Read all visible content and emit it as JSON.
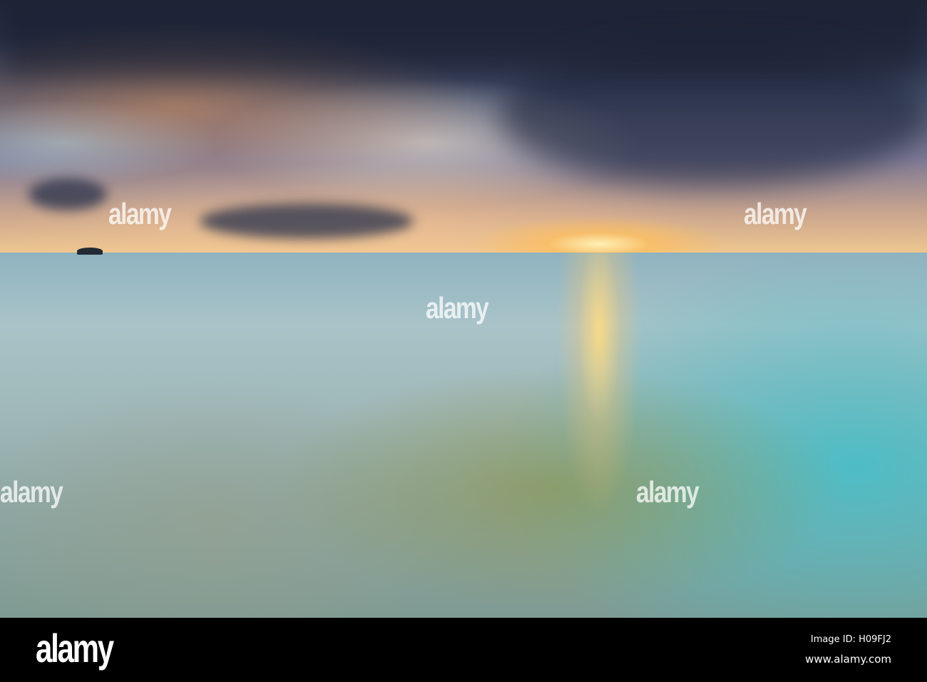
{
  "watermark": {
    "text": "alamy"
  },
  "footer": {
    "logo": "alamy",
    "image_id": "Image ID: H09FJ2",
    "url": "www.alamy.com"
  }
}
